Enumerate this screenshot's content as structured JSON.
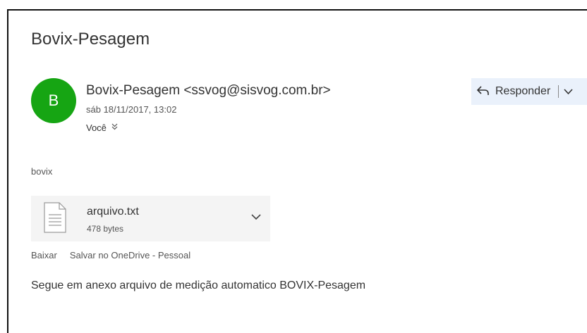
{
  "email": {
    "subject": "Bovix-Pesagem",
    "avatar_initial": "B",
    "avatar_color": "#16a513",
    "sender": "Bovix-Pesagem <ssvog@sisvog.com.br>",
    "datetime": "sáb 18/11/2017, 13:02",
    "recipient": "Você",
    "recipient_expand_icon": "double-chevron-down-icon",
    "body_intro": "bovix",
    "message": "Segue em anexo arquivo de medição automatico BOVIX-Pesagem"
  },
  "reply_button": {
    "label": "Responder",
    "icon": "reply-arrow-icon",
    "dropdown_icon": "chevron-down-icon",
    "background": "#eaf1fb"
  },
  "attachment": {
    "icon": "text-file-icon",
    "file_name": "arquivo.txt",
    "file_size": "478 bytes",
    "expand_icon": "chevron-down-icon"
  },
  "attachment_actions": {
    "download": "Baixar",
    "save_onedrive": "Salvar no OneDrive - Pessoal"
  }
}
